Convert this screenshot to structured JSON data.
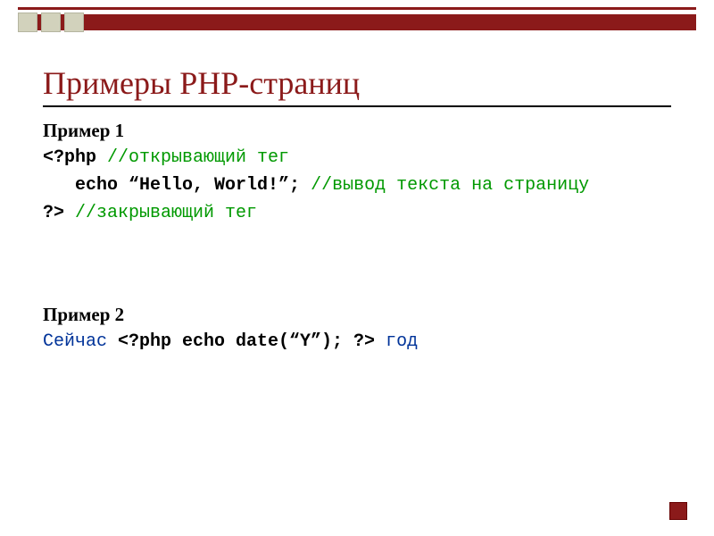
{
  "title": "Примеры PHP-страниц",
  "example1": {
    "label": "Пример 1",
    "line1_open": "<?php ",
    "line1_comment": "//открывающий тег",
    "line2_indent": "   ",
    "line2_code": "echo “Hello, World!”;",
    "line2_comment": " //вывод текста на страницу",
    "line3_close": "?> ",
    "line3_comment": "//закрывающий тег"
  },
  "example2": {
    "label": "Пример 2",
    "pre": "Сейчас ",
    "code": "<?php echo date(“Y”); ?>",
    "post": " год"
  }
}
